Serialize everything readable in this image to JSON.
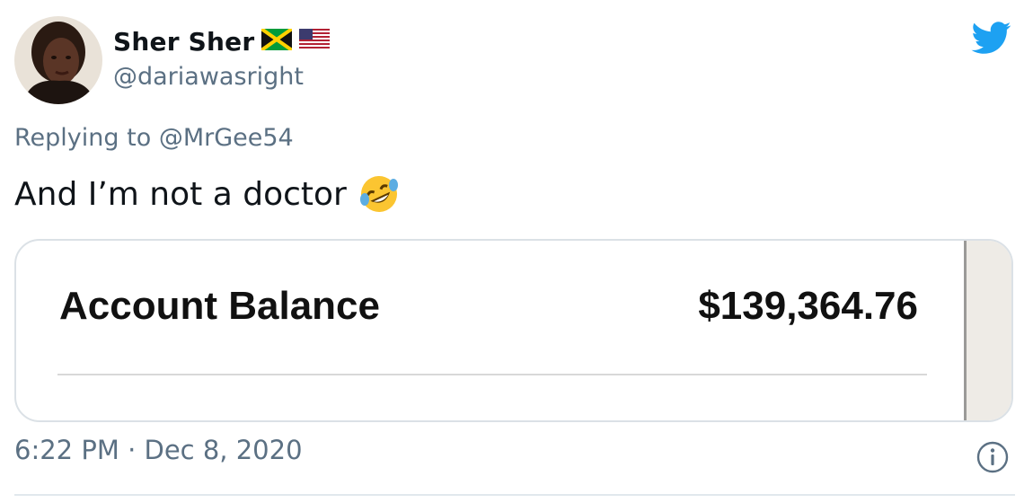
{
  "author": {
    "display_name": "Sher Sher",
    "handle": "@dariawasright",
    "flags": [
      "jamaica-flag-icon",
      "usa-flag-icon"
    ]
  },
  "brand": {
    "icon": "twitter-bird-icon",
    "color": "#1da1f2"
  },
  "reply": {
    "prefix": "Replying to",
    "mention": "@MrGee54"
  },
  "tweet": {
    "text": "And I’m not a doctor",
    "emoji": "rolling-on-floor-laughing-emoji"
  },
  "media": {
    "label": "Account Balance",
    "value": "$139,364.76"
  },
  "meta": {
    "timestamp": "6:22 PM · Dec 8, 2020",
    "info_icon": "info-icon"
  },
  "colors": {
    "text": "#0f1419",
    "secondary": "#5b7083",
    "border": "#dbe1e6"
  }
}
